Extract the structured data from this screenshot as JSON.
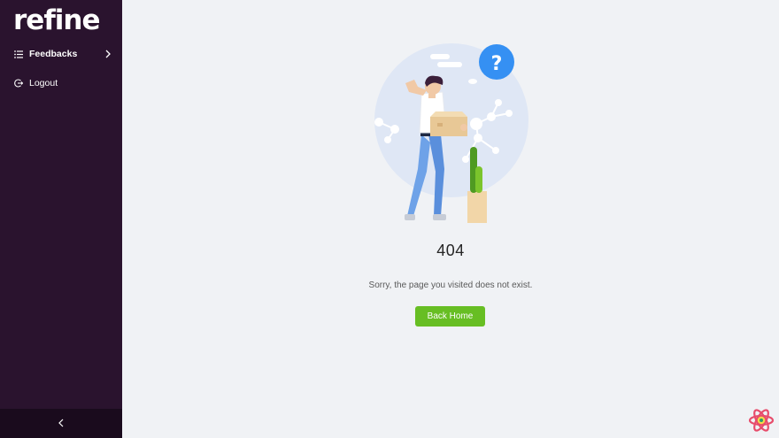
{
  "sidebar": {
    "logo": "refine",
    "items": [
      {
        "label": "Feedbacks",
        "icon": "list-icon",
        "has_submenu": true
      },
      {
        "label": "Logout",
        "icon": "logout-icon"
      }
    ],
    "collapse_icon": "chevron-left-icon",
    "background": "#2a132e"
  },
  "result": {
    "title": "404",
    "subtitle": "Sorry, the page you visited does not exist.",
    "button_label": "Back Home",
    "button_color": "#67be23",
    "illustration": "confused-person-with-box-illustration"
  },
  "devtools_icon": "refine-devtools-icon"
}
